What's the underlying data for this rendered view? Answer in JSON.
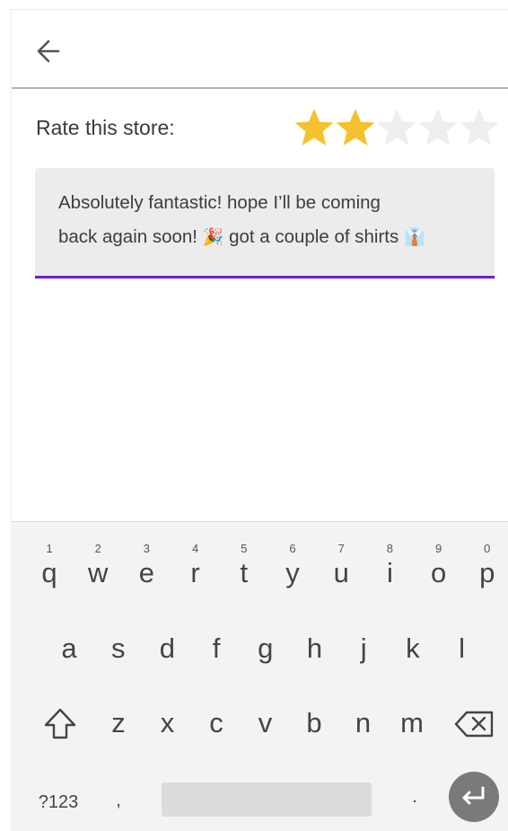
{
  "rating": {
    "label": "Rate this store:",
    "value": 2,
    "max": 5,
    "filled_color": "#f5c12e",
    "empty_color": "#eeeeee"
  },
  "review": {
    "line1": "Absolutely fantastic! hope I’ll be coming",
    "line2_part1": "back again soon! ",
    "emoji1": "🎉",
    "line2_part2": " got a couple of shirts ",
    "emoji2": "👔",
    "accent_color": "#6a1fd8"
  },
  "keyboard": {
    "row1": [
      {
        "ch": "q",
        "hint": "1"
      },
      {
        "ch": "w",
        "hint": "2"
      },
      {
        "ch": "e",
        "hint": "3"
      },
      {
        "ch": "r",
        "hint": "4"
      },
      {
        "ch": "t",
        "hint": "5"
      },
      {
        "ch": "y",
        "hint": "6"
      },
      {
        "ch": "u",
        "hint": "7"
      },
      {
        "ch": "i",
        "hint": "8"
      },
      {
        "ch": "o",
        "hint": "9"
      },
      {
        "ch": "p",
        "hint": "0"
      }
    ],
    "row2": [
      "a",
      "s",
      "d",
      "f",
      "g",
      "h",
      "j",
      "k",
      "l"
    ],
    "row3": [
      "z",
      "x",
      "c",
      "v",
      "b",
      "n",
      "m"
    ],
    "symbols_label": "?123",
    "comma_label": ",",
    "period_label": "."
  },
  "icons": {
    "back": "arrow-left-icon",
    "star": "star-icon",
    "shift": "shift-icon",
    "backspace": "backspace-icon",
    "enter": "enter-icon"
  }
}
